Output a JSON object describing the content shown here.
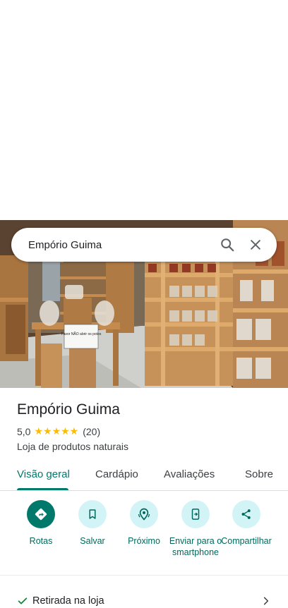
{
  "search": {
    "query": "Empório Guima"
  },
  "photo": {
    "sign_text": "Favor NÃO abrir os potes"
  },
  "place": {
    "name": "Empório Guima",
    "rating": "5,0",
    "stars": "★★★★★",
    "review_count": "(20)",
    "category": "Loja de produtos naturais"
  },
  "tabs": [
    {
      "label": "Visão geral",
      "active": true
    },
    {
      "label": "Cardápio"
    },
    {
      "label": "Avaliações"
    },
    {
      "label": "Sobre"
    }
  ],
  "actions": [
    {
      "label": "Rotas",
      "icon": "directions-icon"
    },
    {
      "label": "Salvar",
      "icon": "bookmark-icon"
    },
    {
      "label": "Próximo",
      "icon": "nearby-icon"
    },
    {
      "label": "Enviar para o smartphone",
      "icon": "send-to-phone-icon"
    },
    {
      "label": "Compartilhar",
      "icon": "share-icon"
    }
  ],
  "attributes": {
    "pickup": "Retirada na loja"
  },
  "colors": {
    "accent": "#00796b",
    "action_bg": "#d3f4f6",
    "star": "#fbbc04"
  }
}
